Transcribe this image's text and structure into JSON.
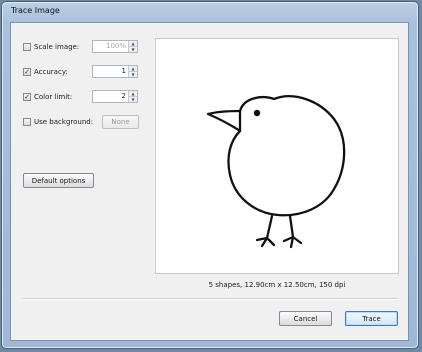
{
  "window": {
    "title": "Trace Image"
  },
  "options": {
    "scale_image": {
      "label": "Scale image:",
      "checked": false,
      "value": "100%"
    },
    "accuracy": {
      "label": "Accuracy:",
      "checked": true,
      "value": "1"
    },
    "color_limit": {
      "label": "Color limit:",
      "checked": true,
      "value": "2"
    },
    "use_background": {
      "label": "Use background:",
      "checked": false,
      "button_label": "None"
    },
    "default_button": "Default options"
  },
  "preview": {
    "status": "5 shapes, 12.90cm x 12.50cm, 150 dpi"
  },
  "buttons": {
    "cancel": "Cancel",
    "trace": "Trace"
  }
}
